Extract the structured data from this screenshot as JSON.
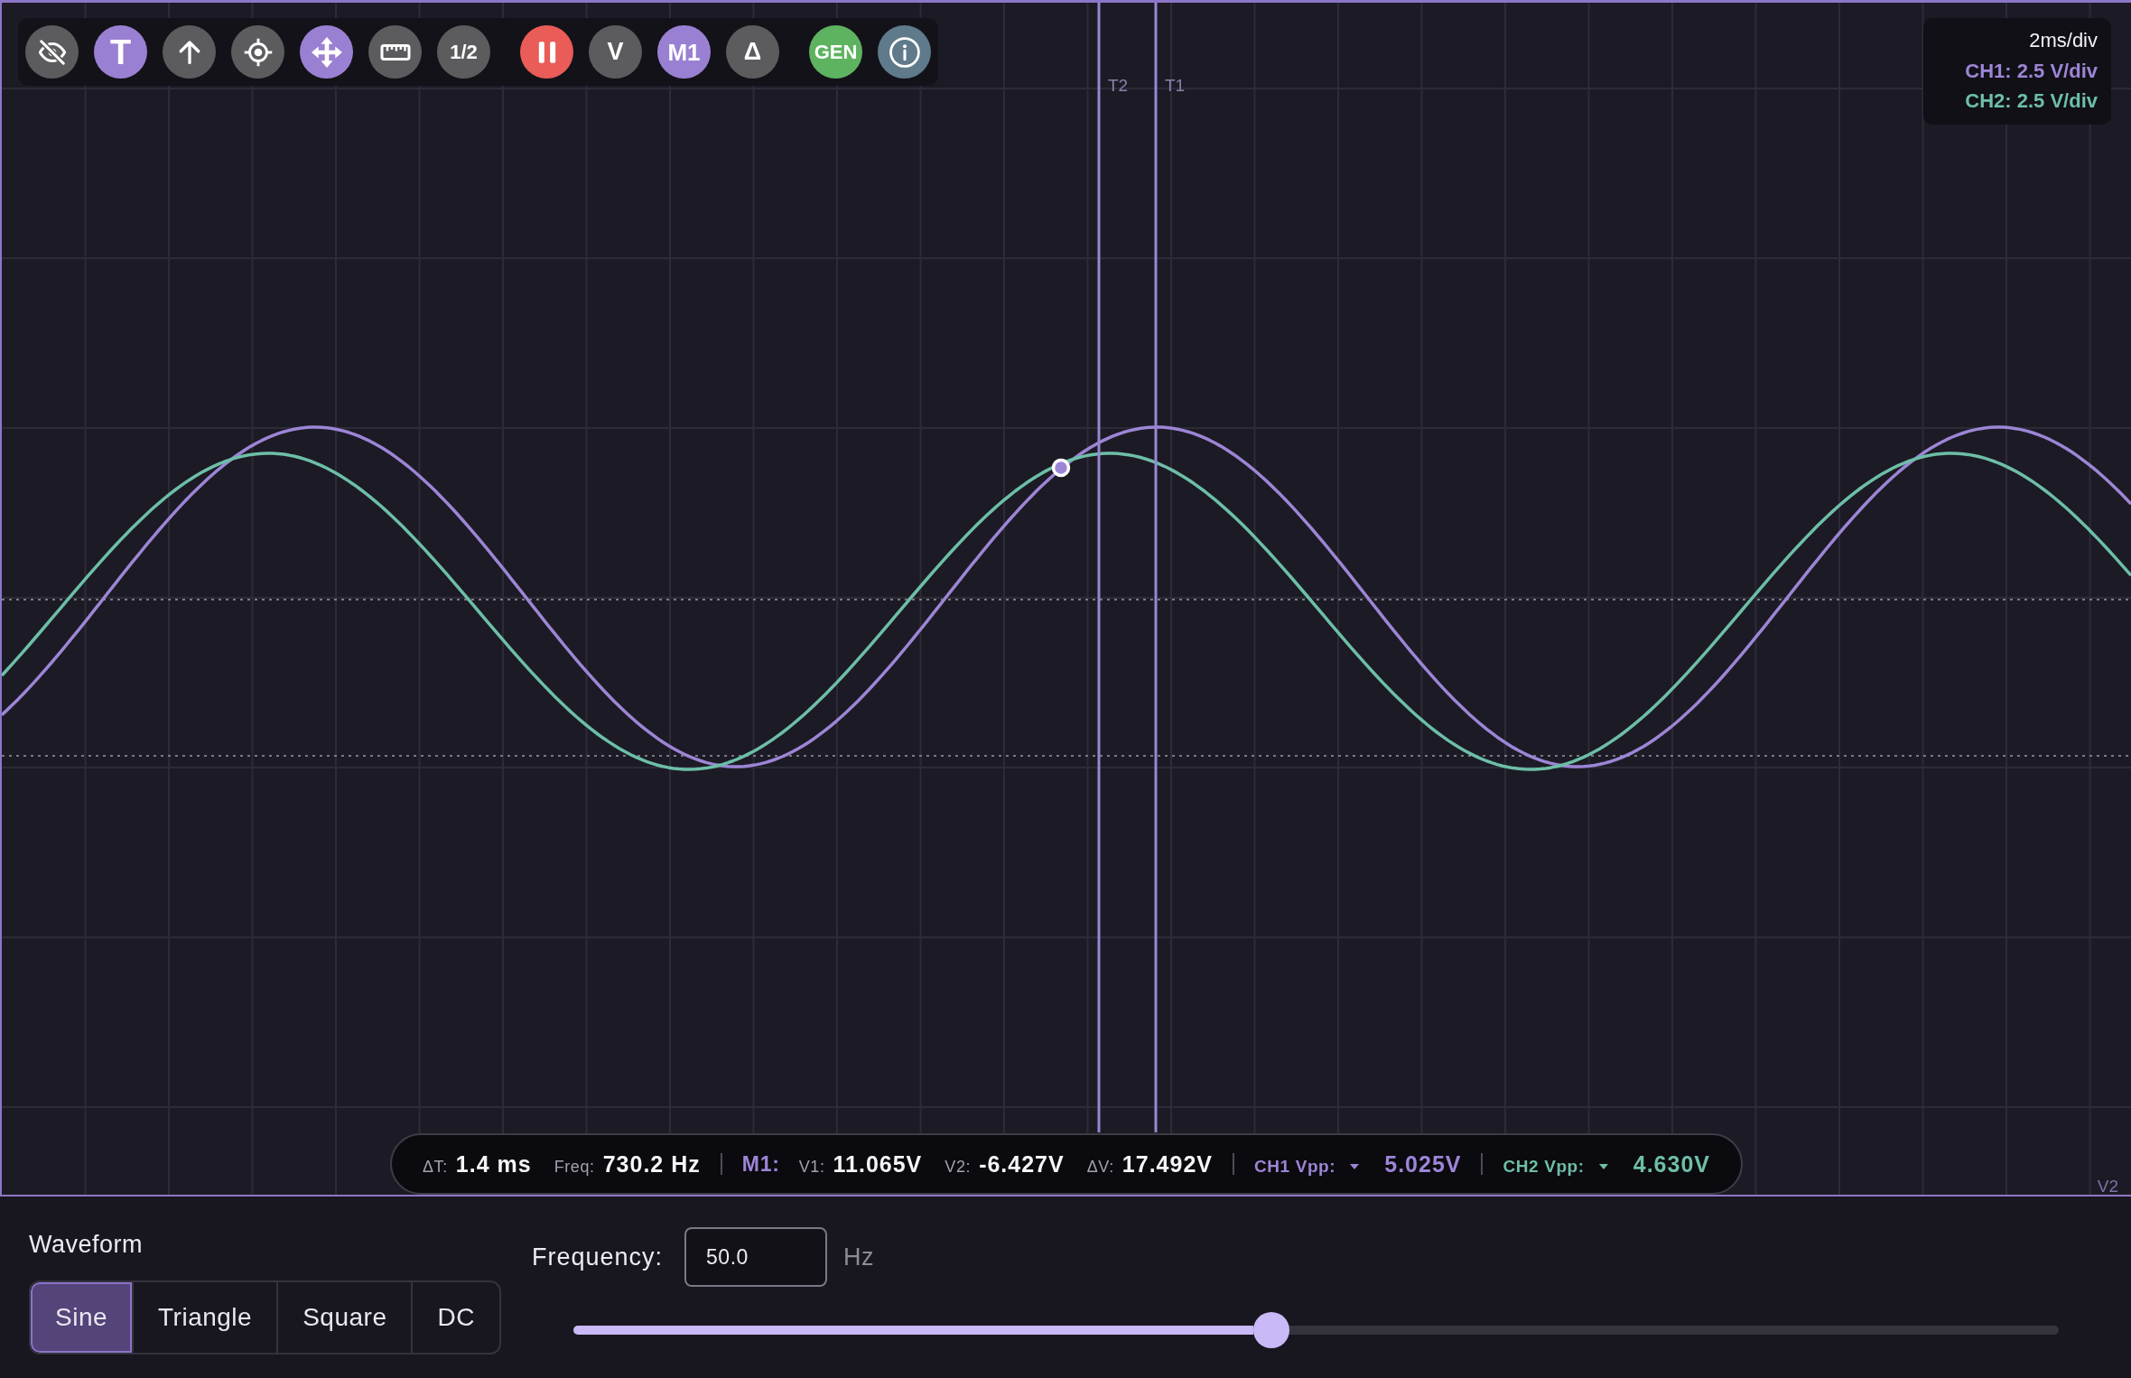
{
  "toolbar": {
    "groups": [
      [
        {
          "kind": "icon",
          "color": "#5c5c5f"
        },
        {
          "kind": "text",
          "text": "T",
          "color": "#9a80d2"
        },
        {
          "kind": "icon",
          "color": "#5c5c5f"
        },
        {
          "kind": "icon",
          "color": "#5c5c5f"
        },
        {
          "kind": "icon",
          "color": "#9a80d2"
        },
        {
          "kind": "icon",
          "color": "#5c5c5f"
        },
        {
          "kind": "text",
          "text": "1/2",
          "color": "#5c5c5f"
        }
      ],
      [
        {
          "kind": "icon",
          "color": "#e95c58"
        },
        {
          "kind": "text",
          "text": "V",
          "color": "#5c5c5f"
        },
        {
          "kind": "text",
          "text": "M1",
          "color": "#9a80d2"
        },
        {
          "kind": "text",
          "text": "Δ",
          "color": "#5c5c5f"
        }
      ],
      [
        {
          "kind": "text",
          "text": "GEN",
          "color": "#5db35f"
        },
        {
          "kind": "icon",
          "color": "#5f7a8a"
        }
      ]
    ]
  },
  "scale_readout": {
    "timebase": "2ms/div",
    "channels": [
      {
        "label": "CH1: 2.5 V/div",
        "color": "#9d85d6"
      },
      {
        "label": "CH2: 2.5 V/div",
        "color": "#6dbfa7"
      }
    ]
  },
  "time_cursors": [
    {
      "label": "T2"
    },
    {
      "label": "T1"
    }
  ],
  "voltage_cursor_label": "V2",
  "readout_bar": {
    "groups": [
      [
        {
          "kind": "pair",
          "label": "ΔT:",
          "value": "1.4 ms"
        },
        {
          "kind": "pair",
          "label": "Freq:",
          "value": "730.2 Hz"
        }
      ],
      [
        {
          "kind": "heading",
          "text": "M1:"
        },
        {
          "kind": "pair",
          "label": "V1:",
          "value": "11.065V"
        },
        {
          "kind": "pair",
          "label": "V2:",
          "value": "-6.427V"
        },
        {
          "kind": "pair",
          "label": "ΔV:",
          "value": "17.492V"
        }
      ],
      [
        {
          "kind": "dropdown",
          "label": "CH1 Vpp:",
          "value": "5.025V",
          "color": "#9d85d6"
        }
      ],
      [
        {
          "kind": "dropdown",
          "label": "CH2 Vpp:",
          "value": "4.630V",
          "color": "#6dbfa7"
        }
      ]
    ]
  },
  "waveform": {
    "label": "Waveform",
    "options": [
      {
        "label": "Sine",
        "selected": true
      },
      {
        "label": "Triangle",
        "selected": false
      },
      {
        "label": "Square",
        "selected": false
      },
      {
        "label": "DC",
        "selected": false
      }
    ]
  },
  "frequency": {
    "label": "Frequency:",
    "value": "50.0",
    "unit": "Hz",
    "level": 0.47
  }
}
